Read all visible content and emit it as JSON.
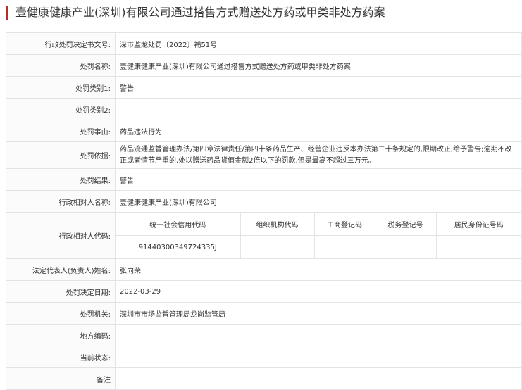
{
  "page": {
    "title": "壹健康健康产业(深圳)有限公司通过搭售方式赠送处方药或甲类非处方药案"
  },
  "fields": {
    "doc_no": {
      "label": "行政处罚决定书文号:",
      "value": "深市监龙处罚〔2022〕補51号"
    },
    "case_name": {
      "label": "处罚名称:",
      "value": "壹健康健康产业(深圳)有限公司通过搭售方式赠送处方药或甲类非处方药案"
    },
    "category1": {
      "label": "处罚类别1:",
      "value": "警告"
    },
    "category2": {
      "label": "处罚类别2:",
      "value": ""
    },
    "reason": {
      "label": "处罚事由:",
      "value": "药品违法行为"
    },
    "basis": {
      "label": "处罚依据:",
      "value": "药品流通监督管理办法/第四章法律责任/第四十条药品生产、经营企业违反本办法第二十条规定的,限期改正,给予警告;逾期不改正或者情节严重的,处以赠送药品货值金额2倍以下的罚款,但是最高不超过三万元。"
    },
    "result": {
      "label": "处罚结果:",
      "value": "警告"
    },
    "party_name": {
      "label": "行政相对人名称:",
      "value": "壹健康健康产业(深圳)有限公司"
    },
    "party_code": {
      "label": "行政相对人代码:",
      "headers": [
        "统一社会信用代码",
        "组织机构代码",
        "工商登记码",
        "税务登记号",
        "居民身份证号码"
      ],
      "values": [
        "91440300349724335J",
        "",
        "",
        "",
        ""
      ]
    },
    "legal_rep": {
      "label": "法定代表人(负责人)姓名:",
      "value": "张向荣"
    },
    "decision_date": {
      "label": "处罚决定日期:",
      "value": "2022-03-29"
    },
    "authority": {
      "label": "处罚机关:",
      "value": "深圳市市场监督管理局龙岗监管局"
    },
    "area_code": {
      "label": "地方编码:",
      "value": ""
    },
    "status": {
      "label": "当前状态:",
      "value": ""
    },
    "remark": {
      "label": "备注",
      "value": ""
    }
  },
  "colors": {
    "accent": "#b52c2c",
    "border": "#e3e3e3"
  }
}
